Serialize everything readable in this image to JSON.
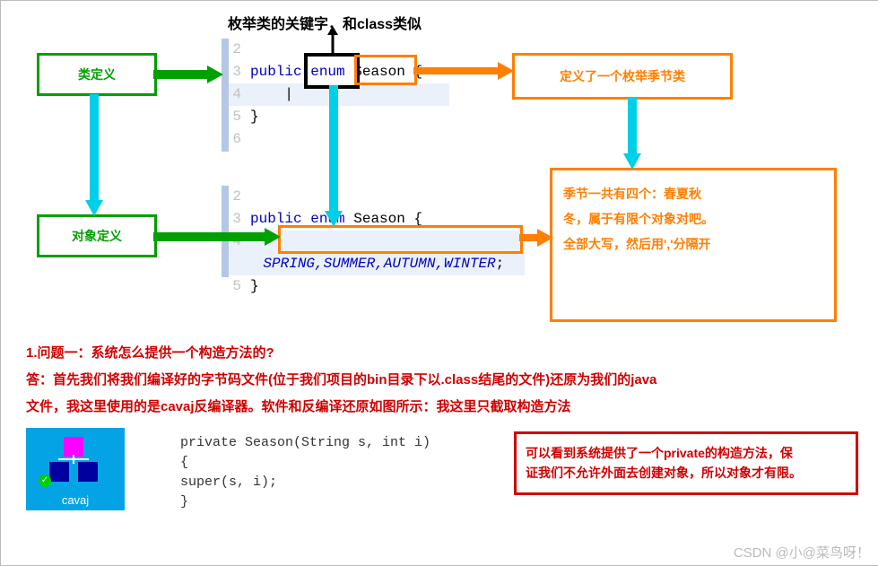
{
  "title_top": "枚举类的关键字，和class类似",
  "box_class_def": "类定义",
  "box_obj_def": "对象定义",
  "box_define_enum": "定义了一个枚举季节类",
  "box_description_l1": "季节一共有四个：春夏秋",
  "box_description_l2": "冬，属于有限个对象对吧。",
  "box_description_l3": "全部大写，然后用','分隔开",
  "code1": {
    "ln2": "2",
    "ln3": "3",
    "ln4": "4",
    "ln5": "5",
    "ln6": "6",
    "kw_public": "public",
    "kw_enum": "enum",
    "type": "Season",
    "brace_open": "{",
    "brace_close": "}"
  },
  "code2": {
    "ln2": "2",
    "ln3": "3",
    "ln4": "4",
    "ln5": "5",
    "kw_public": "public",
    "kw_enum": "enum",
    "type": "Season",
    "brace_open": "{",
    "values": "SPRING,SUMMER,AUTUMN,WINTER",
    "semi": ";",
    "brace_close": "}"
  },
  "qa_q1": "1.问题一：系统怎么提供一个构造方法的?",
  "qa_a1_l1": "答：首先我们将我们编译好的字节码文件(位于我们项目的bin目录下以.class结尾的文件)还原为我们的java",
  "qa_a1_l2": "文件，我这里使用的是cavaj反编译器。软件和反编译还原如图所示：我这里只截取构造方法",
  "icon_label": "cavaj",
  "decompile_l1": "private Season(String s, int i)",
  "decompile_l2": "{",
  "decompile_l3": "    super(s, i);",
  "decompile_l4": "}",
  "red_note_l1": "可以看到系统提供了一个private的构造方法，保",
  "red_note_l2": "证我们不允许外面去创建对象，所以对象才有限。",
  "watermark": "CSDN @小@菜鸟呀！"
}
